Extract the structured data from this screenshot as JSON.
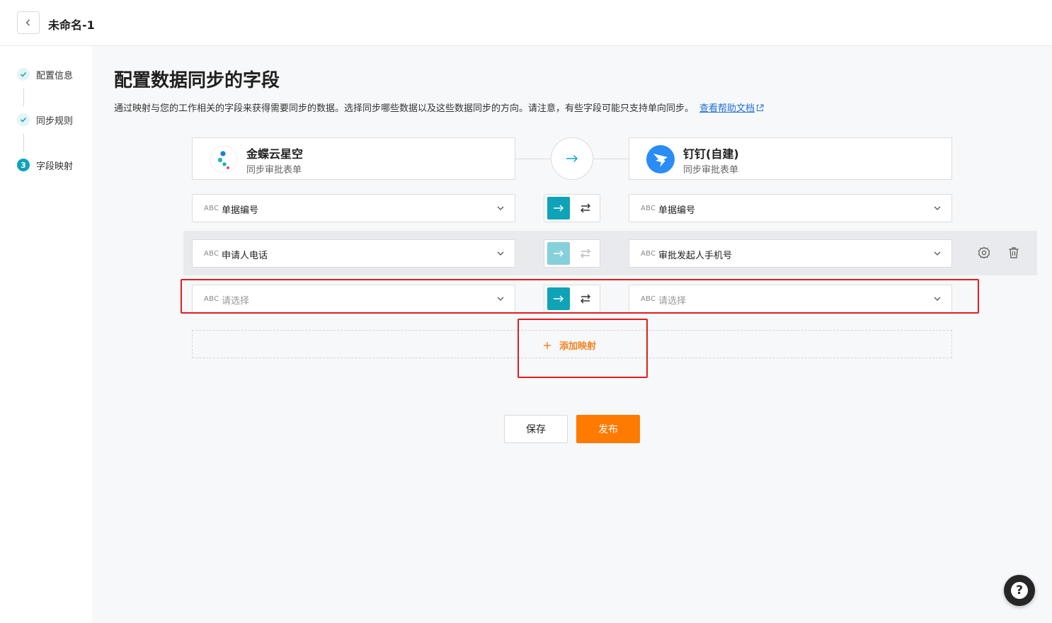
{
  "header": {
    "title": "未命名-1"
  },
  "steps": [
    {
      "label": "配置信息",
      "state": "done"
    },
    {
      "label": "同步规则",
      "state": "done"
    },
    {
      "label": "字段映射",
      "state": "active",
      "number": "3"
    }
  ],
  "main": {
    "title": "配置数据同步的字段",
    "description": "通过映射与您的工作相关的字段来获得需要同步的数据。选择同步哪些数据以及这些数据同步的方向。请注意，有些字段可能只支持单向同步。",
    "help_link": "查看帮助文档"
  },
  "source_app": {
    "name": "金蝶云星空",
    "subtitle": "同步审批表单"
  },
  "target_app": {
    "name": "钉钉(自建)",
    "subtitle": "同步审批表单"
  },
  "field_type_tag": "ABC",
  "mappings": [
    {
      "source": "单据编号",
      "target": "单据编号",
      "direction": "one-way"
    },
    {
      "source": "申请人电话",
      "target": "审批发起人手机号",
      "direction": "one-way"
    },
    {
      "source": "请选择",
      "target": "请选择",
      "direction": "one-way",
      "placeholder": true
    }
  ],
  "add_mapping_label": "添加映射",
  "footer": {
    "save_label": "保存",
    "publish_label": "发布"
  },
  "help_button": {
    "glyph": "?"
  },
  "colors": {
    "accent": "#0fa3b8",
    "primary_button": "#ff7a00",
    "add_text": "#f5821f",
    "link": "#1f6fd8",
    "annotation": "#e11d1d"
  }
}
